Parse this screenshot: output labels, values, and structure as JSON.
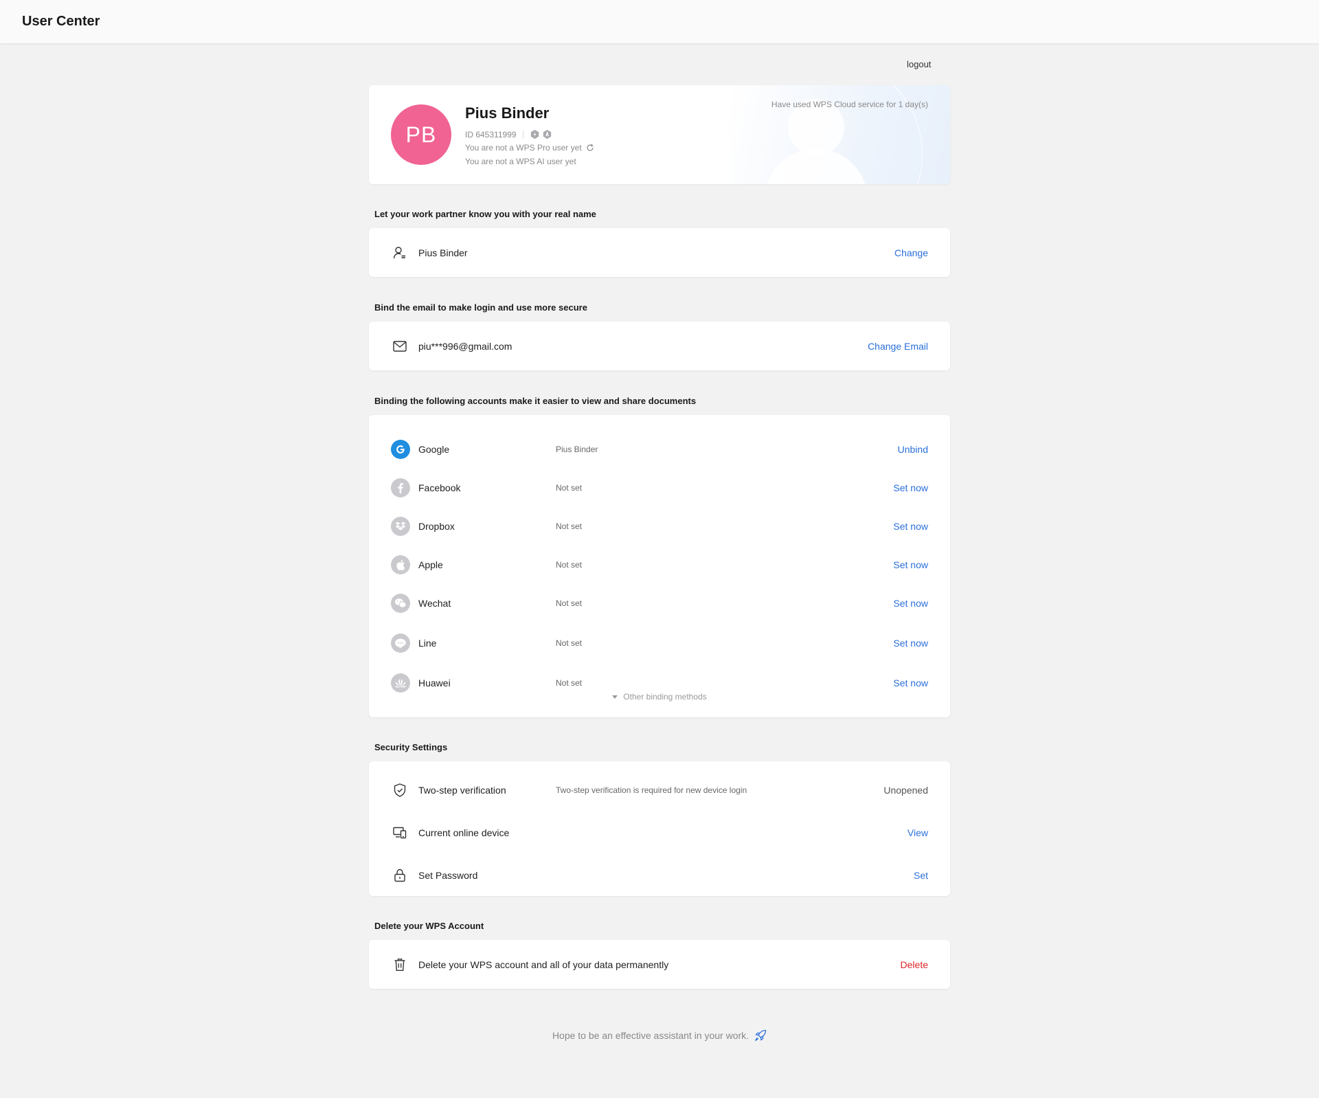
{
  "header": {
    "title": "User Center"
  },
  "logout_label": "logout",
  "profile": {
    "initials": "PB",
    "name": "Pius Binder",
    "id_text": "ID 645311999",
    "pro_status": "You are not a WPS Pro user yet",
    "ai_status": "You are not a WPS AI user yet",
    "usage": "Have used WPS Cloud service for 1 day(s)",
    "avatar_color": "#f06392"
  },
  "real_name": {
    "heading": "Let your work partner know you with your real name",
    "value": "Pius Binder",
    "action": "Change"
  },
  "email": {
    "heading": "Bind the email to make login and use more secure",
    "value": "piu***996@gmail.com",
    "action": "Change Email"
  },
  "bindings": {
    "heading": "Binding the following accounts make it easier to view and share documents",
    "items": [
      {
        "name": "Google",
        "status": "Pius Binder",
        "action": "Unbind",
        "icon": "google-icon"
      },
      {
        "name": "Facebook",
        "status": "Not set",
        "action": "Set now",
        "icon": "facebook-icon"
      },
      {
        "name": "Dropbox",
        "status": "Not set",
        "action": "Set now",
        "icon": "dropbox-icon"
      },
      {
        "name": "Apple",
        "status": "Not set",
        "action": "Set now",
        "icon": "apple-icon"
      },
      {
        "name": "Wechat",
        "status": "Not set",
        "action": "Set now",
        "icon": "wechat-icon"
      },
      {
        "name": "Line",
        "status": "Not set",
        "action": "Set now",
        "icon": "line-icon"
      },
      {
        "name": "Huawei",
        "status": "Not set",
        "action": "Set now",
        "icon": "huawei-icon"
      }
    ],
    "other_methods": "Other binding methods"
  },
  "security": {
    "heading": "Security Settings",
    "items": [
      {
        "name": "Two-step verification",
        "desc": "Two-step verification is required for new device login",
        "action": "Unopened",
        "icon": "shield-check-icon"
      },
      {
        "name": "Current online device",
        "desc": "",
        "action": "View",
        "icon": "devices-icon"
      },
      {
        "name": "Set Password",
        "desc": "",
        "action": "Set",
        "icon": "lock-icon"
      }
    ]
  },
  "delete_account": {
    "heading": "Delete your WPS Account",
    "desc": "Delete your WPS account and all of your data permanently",
    "action": "Delete"
  },
  "footer": {
    "text": "Hope to be an effective assistant in your work."
  },
  "colors": {
    "link": "#2a6fdb",
    "danger": "#e0242b",
    "background": "#f2f2f2"
  }
}
